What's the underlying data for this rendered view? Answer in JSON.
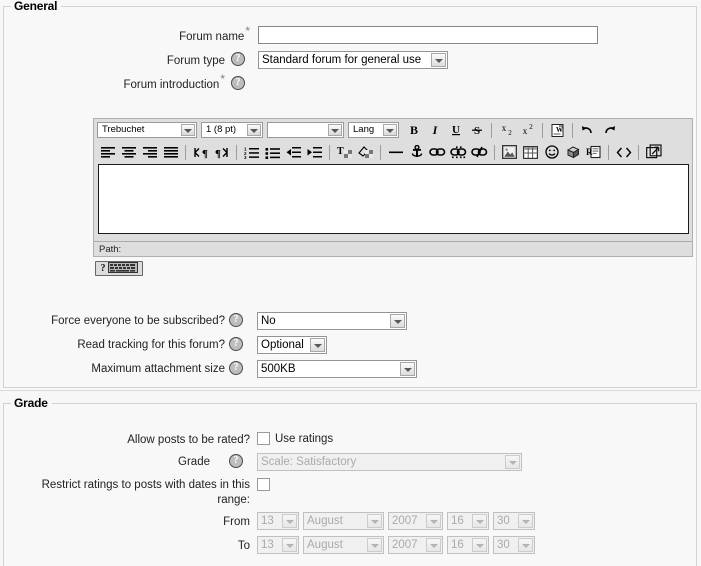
{
  "sections": {
    "general": {
      "legend": "General",
      "fields": {
        "forum_name": {
          "label": "Forum name",
          "required": "*",
          "value": "",
          "placeholder": ""
        },
        "forum_type": {
          "label": "Forum type",
          "help": "?",
          "value": "Standard forum for general use"
        },
        "forum_intro": {
          "label": "Forum introduction",
          "required": "*",
          "help": "?"
        },
        "force_subscribe": {
          "label": "Force everyone to be subscribed?",
          "help": "?",
          "value": "No"
        },
        "read_tracking": {
          "label": "Read tracking for this forum?",
          "help": "?",
          "value": "Optional"
        },
        "max_attachment": {
          "label": "Maximum attachment size",
          "help": "?",
          "value": "500KB"
        }
      }
    },
    "grade": {
      "legend": "Grade",
      "fields": {
        "allow_rated": {
          "label": "Allow posts to be rated?",
          "checkbox_label": "Use ratings",
          "checked": false
        },
        "grade": {
          "label": "Grade",
          "help": "?",
          "value": "Scale: Satisfactory",
          "disabled": true
        },
        "restrict": {
          "label": "Restrict ratings to posts with dates in this range:",
          "checked": false
        },
        "from": {
          "label": "From",
          "day": "13",
          "month": "August",
          "year": "2007",
          "hour": "16",
          "minute": "30",
          "disabled": true
        },
        "to": {
          "label": "To",
          "day": "13",
          "month": "August",
          "year": "2007",
          "hour": "16",
          "minute": "30",
          "disabled": true
        }
      }
    }
  },
  "editor": {
    "font_family": "Trebuchet",
    "font_size": "1 (8 pt)",
    "format": "",
    "language": "Lang",
    "content": "",
    "path_label": "Path:",
    "path_value": "",
    "keyboard_button": {
      "question": "?",
      "icon": "keyboard-icon"
    },
    "toolbar_row1": [
      "align-left-icon",
      "align-center-icon",
      "align-right-icon",
      "align-justify-icon",
      "direction-ltr-icon",
      "direction-rtl-icon",
      "ordered-list-icon",
      "unordered-list-icon",
      "outdent-icon",
      "indent-icon",
      "forecolor-icon",
      "backcolor-icon",
      "horizontal-rule-icon",
      "anchor-icon",
      "insert-link-icon",
      "unlink-icon",
      "nolink-icon",
      "insert-image-icon",
      "insert-table-icon",
      "smiley-icon",
      "media-icon",
      "insert-char-icon",
      "html-source-icon",
      "fullscreen-icon"
    ],
    "toolbar_top_buttons": [
      "bold-icon",
      "italic-icon",
      "underline-icon",
      "strikethrough-icon",
      "subscript-icon",
      "superscript-icon",
      "spellcheck-icon",
      "undo-icon",
      "redo-icon"
    ]
  },
  "colors": {
    "page_bg": "#f7f7f7",
    "fieldset_border": "#d2d2d2",
    "toolbar_bg": "#dedede",
    "disabled_text": "#aaaaaa",
    "required_asterisk": "#808080"
  }
}
